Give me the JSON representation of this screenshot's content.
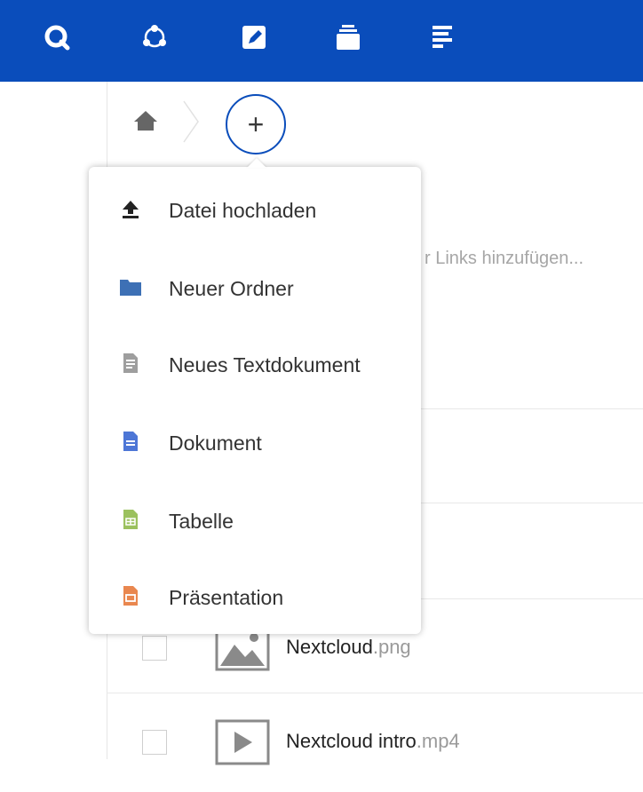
{
  "theme": {
    "header_bg": "#0a4dbb",
    "folder_color": "#3d70b5",
    "text_color": "#9e9e9e",
    "document_color": "#4d76d6",
    "spreadsheet_color": "#9bc15e",
    "presentation_color": "#e9874f"
  },
  "header": {
    "apps": [
      {
        "icon": "search-app-icon"
      },
      {
        "icon": "activity-app-icon"
      },
      {
        "icon": "notes-app-icon"
      },
      {
        "icon": "deck-app-icon"
      },
      {
        "icon": "tasks-app-icon"
      }
    ]
  },
  "breadcrumb": {
    "home_icon": "home-icon",
    "add_button": "+"
  },
  "background": {
    "partial_text": "r Links hinzufügen..."
  },
  "new_menu": {
    "items": [
      {
        "label": "Datei hochladen",
        "icon": "upload-icon"
      },
      {
        "label": "Neuer Ordner",
        "icon": "folder-icon"
      },
      {
        "label": "Neues Textdokument",
        "icon": "text-file-icon"
      },
      {
        "label": "Dokument",
        "icon": "document-icon"
      },
      {
        "label": "Tabelle",
        "icon": "spreadsheet-icon"
      },
      {
        "label": "Präsentation",
        "icon": "presentation-icon"
      }
    ]
  },
  "files": [
    {
      "name": "Nextcloud",
      "ext": ".png",
      "icon": "image-file-icon"
    },
    {
      "name": "Nextcloud intro",
      "ext": ".mp4",
      "icon": "video-file-icon"
    }
  ]
}
